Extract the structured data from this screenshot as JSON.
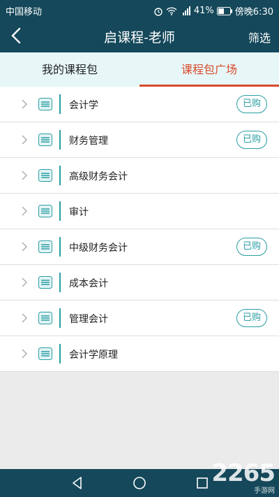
{
  "status_bar": {
    "carrier": "中国移动",
    "signal_label": "⁴ᴳ",
    "battery": "41%",
    "time": "傍晚6:30"
  },
  "nav": {
    "title": "启课程-老师",
    "filter_label": "筛选",
    "back_icon": "chevron-left-icon"
  },
  "tabs": [
    {
      "label": "我的课程包",
      "active": false
    },
    {
      "label": "课程包广场",
      "active": true
    }
  ],
  "courses": [
    {
      "name": "会计学",
      "badge": "已购"
    },
    {
      "name": "财务管理",
      "badge": "已购"
    },
    {
      "name": "高级财务会计",
      "badge": ""
    },
    {
      "name": "审计",
      "badge": ""
    },
    {
      "name": "中级财务会计",
      "badge": "已购"
    },
    {
      "name": "成本会计",
      "badge": ""
    },
    {
      "name": "管理会计",
      "badge": "已购"
    },
    {
      "name": "会计学原理",
      "badge": ""
    }
  ],
  "watermark": {
    "brand": "2265",
    "sub": "手游网"
  },
  "colors": {
    "header": "#14485a",
    "accent": "#2b9ea3",
    "active_tab": "#d94a2c",
    "tab_bg": "#e7f7f8"
  }
}
